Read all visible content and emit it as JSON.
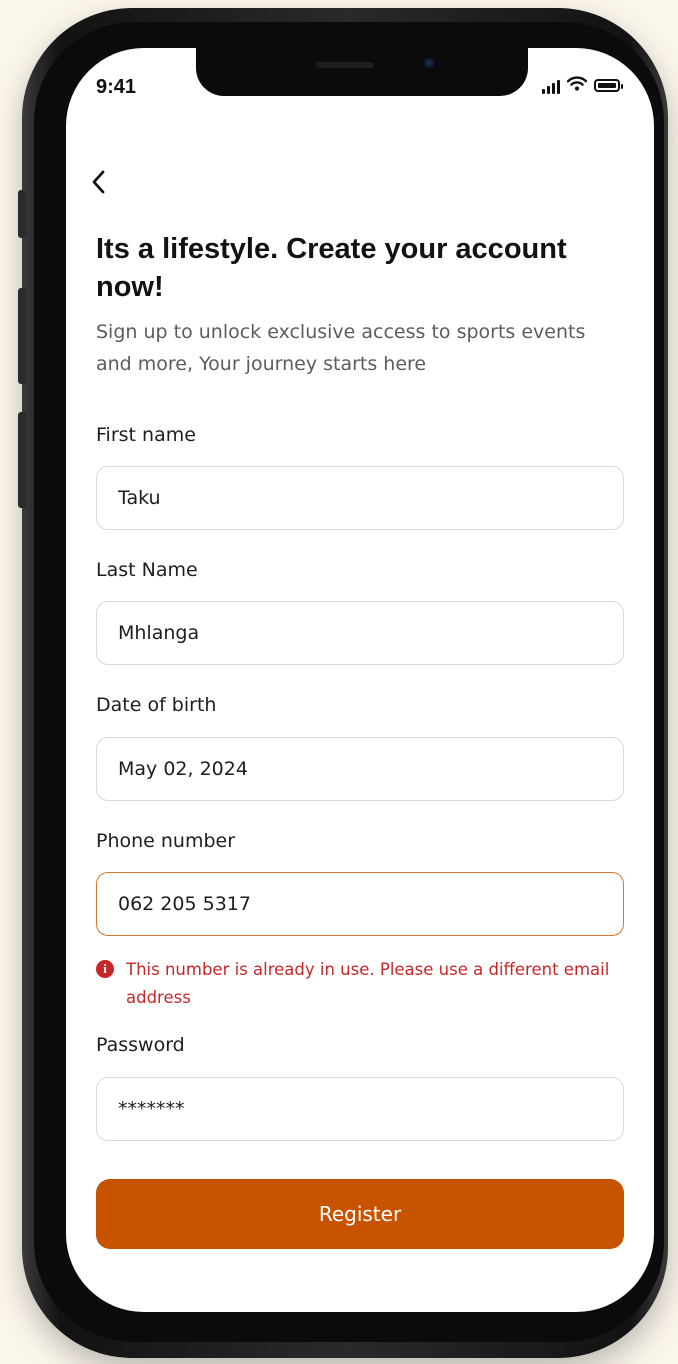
{
  "status_bar": {
    "time": "9:41",
    "icons": [
      "signal-icon",
      "wifi-icon",
      "battery-icon"
    ]
  },
  "header": {
    "back_icon": "chevron-left-icon",
    "title": "Its a lifestyle. Create your account now!",
    "subtitle": "Sign up to unlock exclusive access to sports events and more, Your journey starts here"
  },
  "form": {
    "first_name": {
      "label": "First name",
      "value": "Taku"
    },
    "last_name": {
      "label": "Last Name",
      "value": "Mhlanga"
    },
    "dob": {
      "label": "Date of birth",
      "value": "May 02, 2024"
    },
    "phone": {
      "label": "Phone number",
      "value": "062 205 5317",
      "error": "This number is already in use. Please use a different email address"
    },
    "password": {
      "label": "Password",
      "value": "*******"
    },
    "submit_label": "Register"
  },
  "colors": {
    "accent": "#c75300",
    "error": "#c62828",
    "error_border": "#d4782e",
    "background": "#fbf6ec"
  }
}
